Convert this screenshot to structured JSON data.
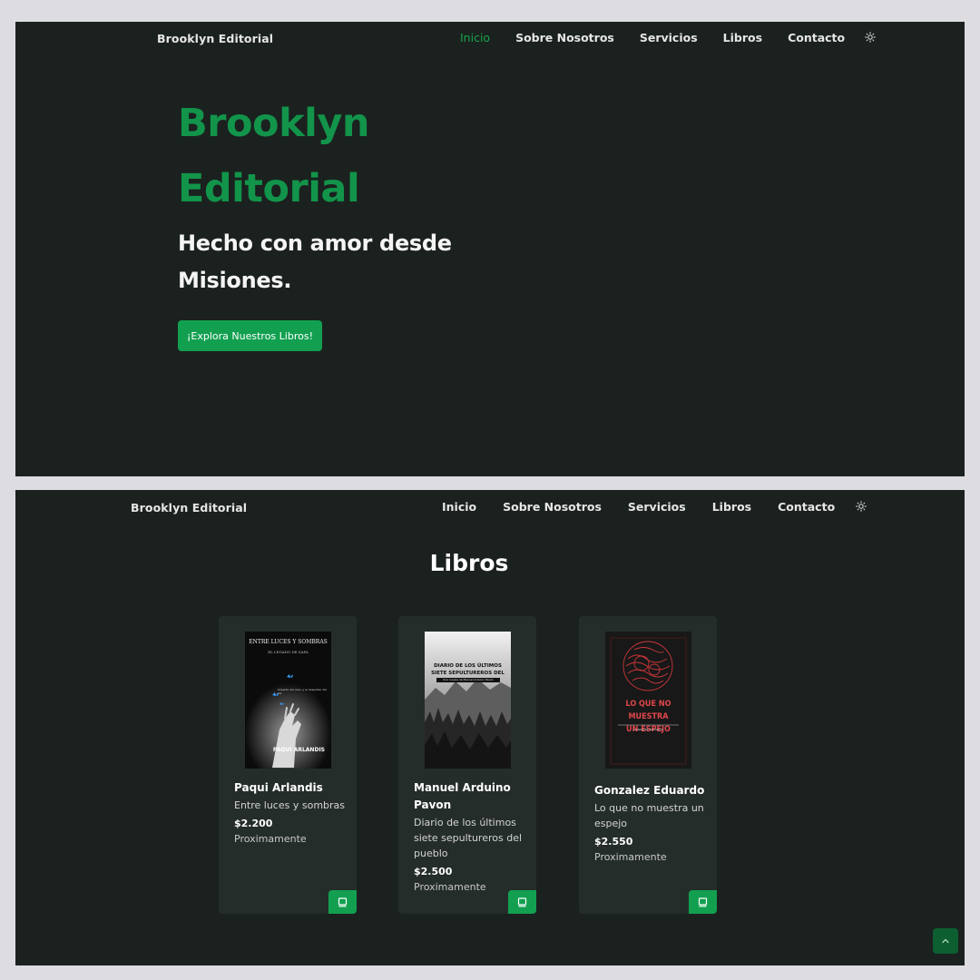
{
  "hero": {
    "brand": "Brooklyn Editorial",
    "nav": [
      "Inicio",
      "Sobre Nosotros",
      "Servicios",
      "Libros",
      "Contacto"
    ],
    "active_nav": "Inicio",
    "title_line1": "Brooklyn",
    "title_line2": "Editorial",
    "subtitle_line1": "Hecho con amor desde",
    "subtitle_line2": "Misiones.",
    "cta_label": "¡Explora Nuestros Libros!"
  },
  "books_section": {
    "brand": "Brooklyn Editorial",
    "nav": [
      "Inicio",
      "Sobre Nosotros",
      "Servicios",
      "Libros",
      "Contacto"
    ],
    "title": "Libros",
    "books": [
      {
        "author": "Paqui Arlandis",
        "title": "Entre luces y sombras",
        "price": "$2.200",
        "status": "Proximamente",
        "cover": {
          "heading": "ENTRE LUCES Y SOMBRAS",
          "subheading": "EL LEGADO DE SAFA",
          "author_line": "PAQUI ARLANDIS",
          "small_text": "Impacto del caos, y el despertar del ser",
          "icons": [
            "butterfly-icon",
            "hand-icon"
          ]
        }
      },
      {
        "author": "Manuel Arduino Pavon",
        "title": "Diario de los últimos siete sepultureros del pueblo",
        "price": "$2.500",
        "status": "Proximamente",
        "cover": {
          "heading": "DIARIO DE LOS ÚLTIMOS SIETE SEPULTUREROS DEL PUEBLO",
          "band_text": "Una novela de Manuel Arduino Pavón"
        }
      },
      {
        "author": "Gonzalez Eduardo",
        "title": "Lo que no muestra un espejo",
        "price": "$2.550",
        "status": "Proximamente",
        "cover": {
          "heading_line1": "LO QUE NO MUESTRA",
          "heading_line2": "UN ESPEJO",
          "author_line": "GONZALEZ EDUARDO"
        }
      }
    ]
  },
  "icons": {
    "theme_toggle": "sun-icon",
    "card_action": "book-icon",
    "scroll_top": "chevron-up-icon"
  },
  "colors": {
    "page_bg": "#dddde1",
    "panel_bg": "#1b211f",
    "card_bg": "#252d2a",
    "accent": "#12a050",
    "title_green": "#12944a"
  }
}
